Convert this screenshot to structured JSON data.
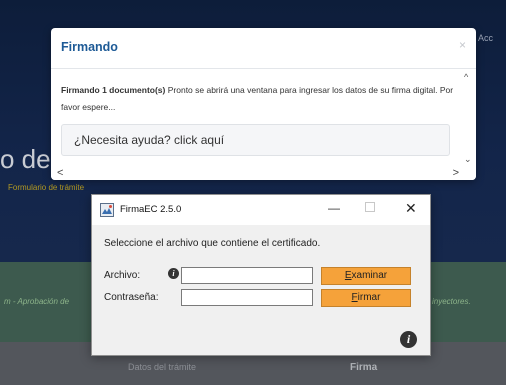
{
  "background": {
    "nav_text": "Acc",
    "heading": "o de",
    "subheading": "Formulario de trámite",
    "band_left": "m - Aprobación de",
    "band_right": "inyectores.",
    "bottom_left": "Datos del trámite",
    "bottom_right": "Firma"
  },
  "modal": {
    "title": "Firmando",
    "close": "×",
    "message_bold": "Firmando 1 documento(s)",
    "message_rest": " Pronto se abrirá una ventana para ingresar los datos de su firma digital. Por favor espere...",
    "help": "¿Necesita ayuda? click aquí",
    "scroll_up": "^",
    "scroll_down": "⌄",
    "scroll_left": "<",
    "scroll_right": ">"
  },
  "firmaec": {
    "title": "FirmaEC 2.5.0",
    "minimize": "—",
    "close": "✕",
    "prompt": "Seleccione el archivo que contiene el certificado.",
    "archivo_label": "Archivo:",
    "archivo_value": "",
    "examinar_first": "E",
    "examinar_rest": "xaminar",
    "password_label": "Contraseña:",
    "password_value": "",
    "firmar_first": "F",
    "firmar_rest": "irmar",
    "info_icon": "i"
  },
  "colors": {
    "modal_title": "#1d5a96",
    "button_accent": "#f5a23a",
    "page_dark": "#13254a"
  }
}
